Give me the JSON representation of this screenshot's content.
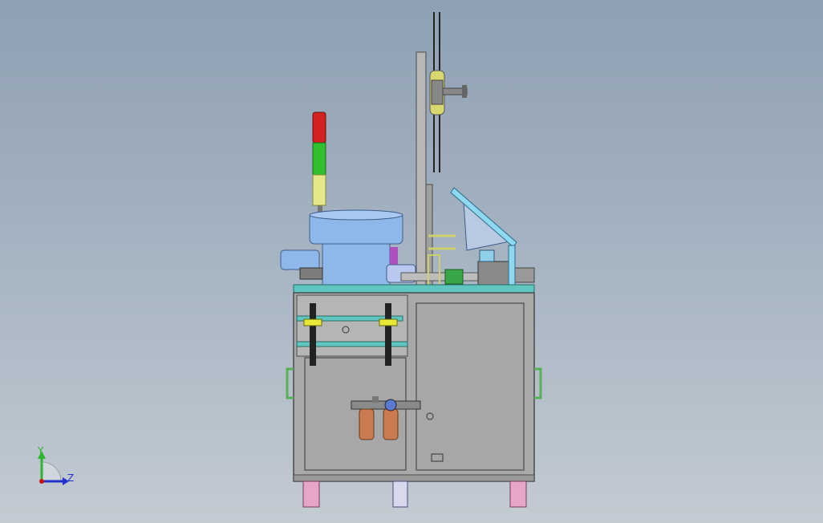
{
  "viewport": {
    "background_top": "#8ea0b3",
    "background_bottom": "#c3cbd3"
  },
  "triad": {
    "y_label": "Y",
    "z_label": "Z",
    "y_color": "#2db52d",
    "z_color": "#2233cc",
    "x_color": "#cc1111"
  },
  "colors": {
    "frame_gray": "#a9a9a9",
    "frame_edge": "#4a4a4a",
    "panel_teal": "#5fc7c0",
    "bowl_blue": "#8fb8ea",
    "signal_red": "#d42020",
    "signal_green": "#2fbf2f",
    "signal_yellow": "#e6e68a",
    "caster_pink": "#e6a6c8",
    "filter_copper": "#c97a4e",
    "handle_green": "#58b058"
  },
  "icons": {
    "signal_tower": "signal-tower-icon",
    "air_filter": "air-filter-regulator-icon",
    "caster": "caster-wheel-icon"
  }
}
